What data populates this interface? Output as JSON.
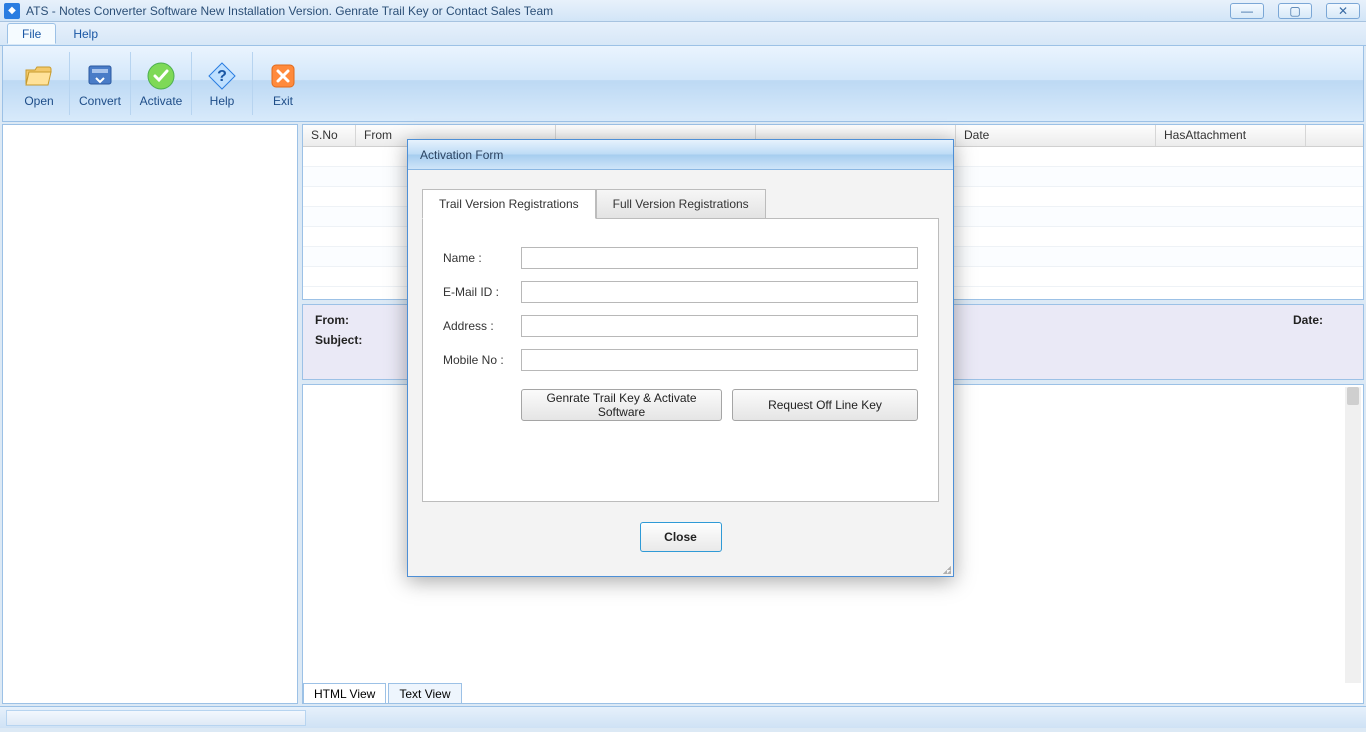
{
  "window": {
    "title": "ATS - Notes Converter Software New Installation Version. Genrate Trail Key or Contact Sales Team"
  },
  "menu": {
    "file": "File",
    "help": "Help"
  },
  "toolbar": {
    "open": "Open",
    "convert": "Convert",
    "activate": "Activate",
    "help": "Help",
    "exit": "Exit"
  },
  "grid": {
    "cols": {
      "sno": "S.No",
      "from": "From",
      "to": "",
      "subject": "",
      "date": "Date",
      "hasAttachment": "HasAttachment"
    }
  },
  "info": {
    "from": "From:",
    "subject": "Subject:",
    "date": "Date:"
  },
  "tabs": {
    "html": "HTML View",
    "text": "Text View"
  },
  "dialog": {
    "title": "Activation Form",
    "tab_trail": "Trail Version Registrations",
    "tab_full": "Full Version Registrations",
    "name": "Name :",
    "email": "E-Mail ID :",
    "address": "Address :",
    "mobile": "Mobile No :",
    "btn_generate": "Genrate Trail Key & Activate Software",
    "btn_offline": "Request Off Line Key",
    "close": "Close"
  }
}
